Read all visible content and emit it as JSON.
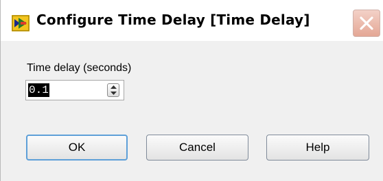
{
  "window": {
    "title": "Configure Time Delay [Time Delay]",
    "title_icon": "labview-express-vi-icon",
    "close_icon": "close-icon"
  },
  "form": {
    "time_delay_label": "Time delay (seconds)",
    "time_delay_value": "0.1",
    "spinner_icon": "up-down-arrows-icon"
  },
  "buttons": {
    "ok_label": "OK",
    "cancel_label": "Cancel",
    "help_label": "Help"
  },
  "colors": {
    "close_button": "#e4a795",
    "default_button_border": "#5d9fd8",
    "selection_highlight": "#000000",
    "dialog_background": "#f0f0f0"
  }
}
